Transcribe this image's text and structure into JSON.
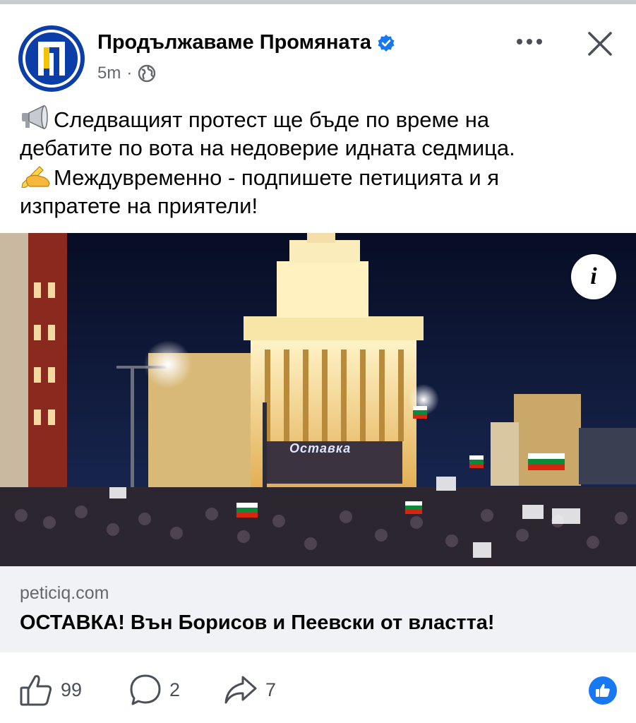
{
  "post": {
    "page_name": "Продължаваме Промяната",
    "verified": true,
    "time": "5m",
    "separator": "·",
    "audience_icon": "globe-icon",
    "text_lines": [
      "Следващият протест ще бъде по време на",
      "дебатите по вота на недоверие идната седмица.",
      "Междувременно - подпишете петицията и я",
      "изпратете на приятели!"
    ],
    "emoji_1": "megaphone-icon",
    "emoji_2": "writing-hand-icon",
    "photo": {
      "description_icon": "info-icon",
      "projection_text": "Оставка"
    },
    "link": {
      "domain": "peticiq.com",
      "title": "ОСТАВКА! Вън Борисов и Пеевски от властта!"
    },
    "stats": {
      "likes": "99",
      "comments": "2",
      "shares": "7"
    }
  },
  "colors": {
    "brand_blue": "#0b3ea8",
    "verified_blue": "#1877f2",
    "secondary_text": "#65676b",
    "link_bg": "#f0f2f5"
  }
}
